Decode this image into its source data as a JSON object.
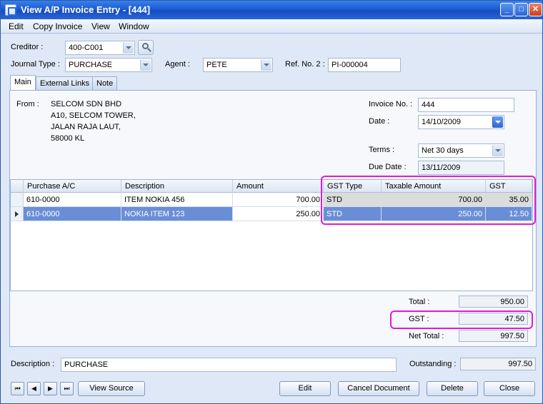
{
  "window": {
    "title": "View A/P Invoice Entry - [444]"
  },
  "menu": [
    "Edit",
    "Copy Invoice",
    "View",
    "Window"
  ],
  "header": {
    "creditor_label": "Creditor :",
    "creditor": "400-C001",
    "journal_type_label": "Journal Type :",
    "journal_type": "PURCHASE",
    "agent_label": "Agent :",
    "agent": "PETE",
    "ref_no2_label": "Ref. No. 2 :",
    "ref_no2": "PI-000004"
  },
  "tabs": [
    "Main",
    "External Links",
    "Note"
  ],
  "main": {
    "from_label": "From :",
    "address": [
      "SELCOM SDN BHD",
      "A10, SELCOM TOWER,",
      "JALAN RAJA LAUT,",
      "58000 KL"
    ],
    "invoice_no_label": "Invoice No. :",
    "invoice_no": "444",
    "date_label": "Date :",
    "date": "14/10/2009",
    "terms_label": "Terms :",
    "terms": "Net 30 days",
    "due_date_label": "Due Date :",
    "due_date": "13/11/2009"
  },
  "grid": {
    "columns": [
      "Purchase A/C",
      "Description",
      "Amount",
      "GST Type",
      "Taxable Amount",
      "GST"
    ],
    "rows": [
      {
        "account": "610-0000",
        "description": "ITEM NOKIA 456",
        "amount": "700.00",
        "gst_type": "STD",
        "taxable": "700.00",
        "gst": "35.00"
      },
      {
        "account": "610-0000",
        "description": "NOKIA ITEM 123",
        "amount": "250.00",
        "gst_type": "STD",
        "taxable": "250.00",
        "gst": "12.50"
      }
    ]
  },
  "totals": {
    "total_label": "Total :",
    "total": "950.00",
    "gst_label": "GST :",
    "gst": "47.50",
    "net_total_label": "Net Total :",
    "net_total": "997.50"
  },
  "footer": {
    "description_label": "Description :",
    "description": "PURCHASE",
    "outstanding_label": "Outstanding :",
    "outstanding": "997.50"
  },
  "buttons": {
    "nav_first": "⏮",
    "nav_prev": "◀",
    "nav_next": "▶",
    "nav_last": "⏭",
    "view_source": "View Source",
    "edit": "Edit",
    "cancel_document": "Cancel Document",
    "delete": "Delete",
    "close": "Close"
  },
  "colors": {
    "highlight": "#e01bd2",
    "selected_row": "#6a8ed6",
    "titlebar": "#1c5bd6"
  }
}
